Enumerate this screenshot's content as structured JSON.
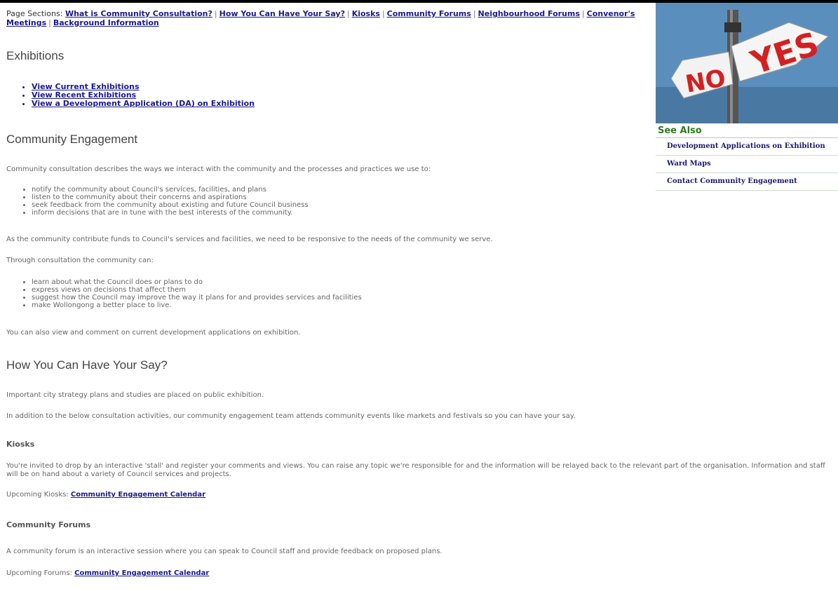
{
  "page_sections": {
    "label": "Page Sections:",
    "links": [
      "What is Community Consultation?",
      "How You Can Have Your Say?",
      "Kiosks",
      "Community Forums",
      "Neighbourhood Forums",
      "Convenor's Meetings",
      "Background Information"
    ]
  },
  "exhibitions": {
    "heading": "Exhibitions",
    "links": [
      "View Current Exhibitions",
      "View Recent Exhibitions",
      "View a Development Application (DA) on Exhibition"
    ]
  },
  "engagement": {
    "heading": "Community Engagement",
    "intro": "Community consultation describes the ways we interact with the community and the processes and practices we use to:",
    "list1": [
      "notify the community about Council's services, facilities, and plans",
      "listen to the community about their concerns and aspirations",
      "seek feedback from the community about existing and future Council business",
      "inform decisions that are in tune with the best interests of the community."
    ],
    "para2": "As the community contribute funds to Council's services and facilities, we need to be responsive to the needs of the community we serve.",
    "para3": "Through consultation the community can:",
    "list2": [
      "learn about what the Council does or plans to do",
      "express views on decisions that affect them",
      "suggest how the Council may improve the way it plans for and provides services and facilities",
      "make Wollongong a better place to live."
    ],
    "para4": "You can also view and comment on current development applications on exhibition."
  },
  "have_say": {
    "heading": "How You Can Have Your Say?",
    "para1": "Important city strategy plans and studies are placed on public exhibition.",
    "para2": "In addition to the below consultation activities, our community engagement team attends community events like markets and festivals so you can have your say."
  },
  "kiosks": {
    "heading": "Kiosks",
    "para": "You're invited to drop by an interactive 'stall' and register your comments and views. You can raise any topic we're responsible for and the information will be relayed back to the relevant part of the organisation. Information and staff will be on hand about a variety of Council services and projects.",
    "upcoming_label": "Upcoming Kiosks:",
    "upcoming_link": "Community Engagement Calendar"
  },
  "forums": {
    "heading": "Community Forums",
    "para": "A community forum is an interactive session where you can speak to Council staff and provide feedback on proposed plans.",
    "upcoming_label": "Upcoming Forums:",
    "upcoming_link": "Community Engagement Calendar"
  },
  "sidebar": {
    "banner_no": "NO",
    "banner_yes": "YES",
    "see_also": "See Also",
    "items": [
      "Development Applications on Exhibition",
      "Ward Maps",
      "Contact Community Engagement"
    ]
  }
}
